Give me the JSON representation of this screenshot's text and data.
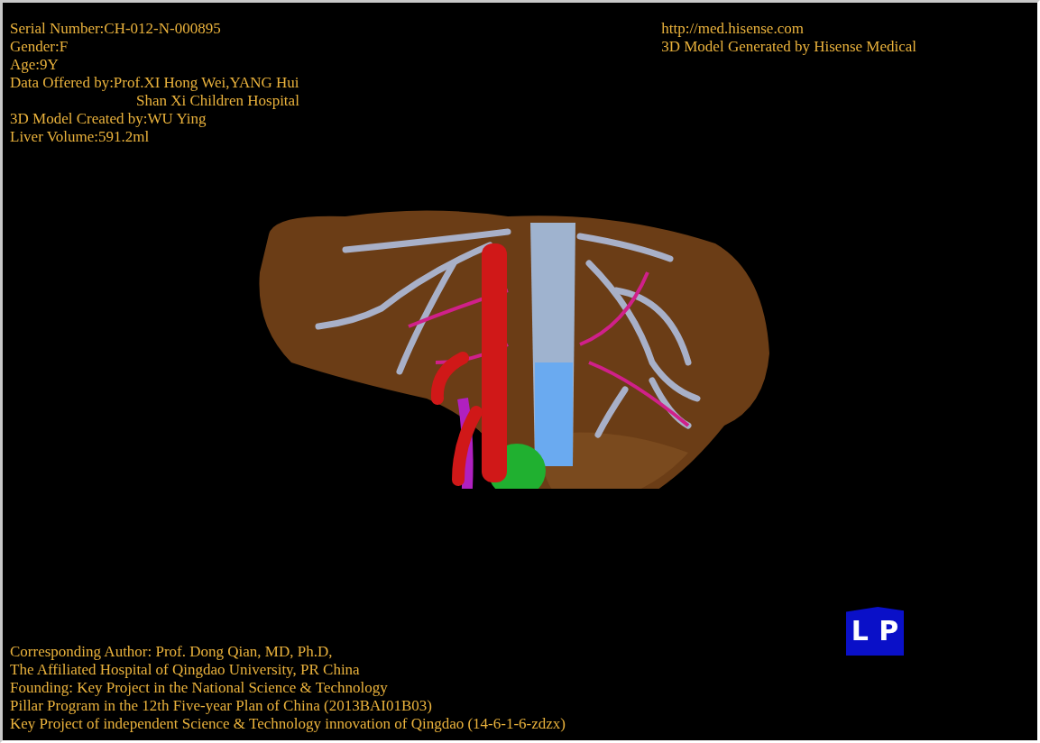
{
  "info_top_left": [
    {
      "text": "Serial Number:CH-012-N-000895",
      "kind": "line"
    },
    {
      "text": "Gender:F",
      "kind": "line"
    },
    {
      "text": "Age:9Y",
      "kind": "line"
    },
    {
      "text": "Data Offered by:Prof.XI Hong Wei,YANG Hui",
      "kind": "line"
    },
    {
      "text": "Shan Xi Children Hospital",
      "kind": "continuation"
    },
    {
      "text": "3D Model Created by:WU Ying",
      "kind": "line"
    },
    {
      "text": "Liver Volume:591.2ml",
      "kind": "line"
    }
  ],
  "info_top_right": [
    "http://med.hisense.com",
    "3D Model Generated by Hisense Medical"
  ],
  "info_bottom_left": [
    "Corresponding Author: Prof. Dong Qian, MD, Ph.D,",
    "The Affiliated Hospital of Qingdao University, PR China",
    "Founding: Key Project in the National Science & Technology",
    "Pillar Program in the 12th Five-year Plan of China (2013BAI01B03)",
    "Key Project of independent Science & Technology innovation of Qingdao (14-6-1-6-zdzx)"
  ],
  "orientation_cube": {
    "labels": [
      "L",
      "P"
    ]
  }
}
